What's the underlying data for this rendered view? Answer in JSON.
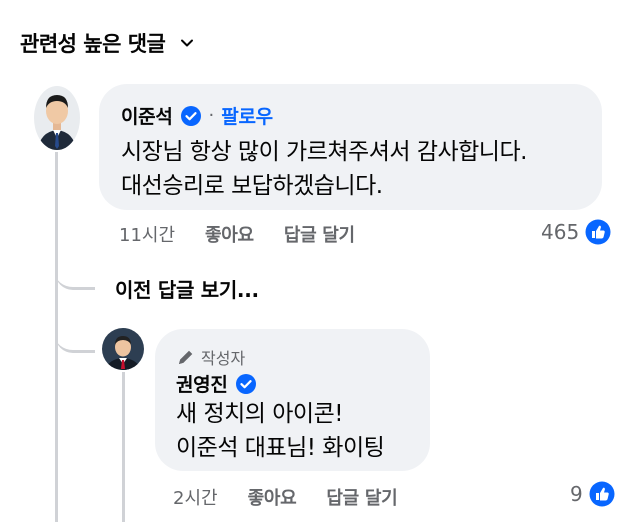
{
  "header": {
    "sort_label": "관련성 높은 댓글"
  },
  "comments": [
    {
      "author": "이준석",
      "follow_label": "팔로우",
      "text_lines": [
        "시장님 항상 많이 가르쳐주셔서 감사합니다.",
        "대선승리로 보답하겠습니다."
      ],
      "time": "11시간",
      "like_label": "좋아요",
      "reply_label": "답글 달기",
      "reaction_count": "465"
    }
  ],
  "view_previous_replies": "이전 답글 보기...",
  "reply": {
    "badge": "작성자",
    "author": "권영진",
    "text_lines": [
      "새 정치의 아이콘!",
      "이준석 대표님! 화이팅"
    ],
    "time": "2시간",
    "like_label": "좋아요",
    "reply_label": "답글 달기",
    "reaction_count": "9"
  },
  "colors": {
    "accent": "#0866ff",
    "bubble": "#f0f2f5",
    "muted": "#65676b"
  }
}
